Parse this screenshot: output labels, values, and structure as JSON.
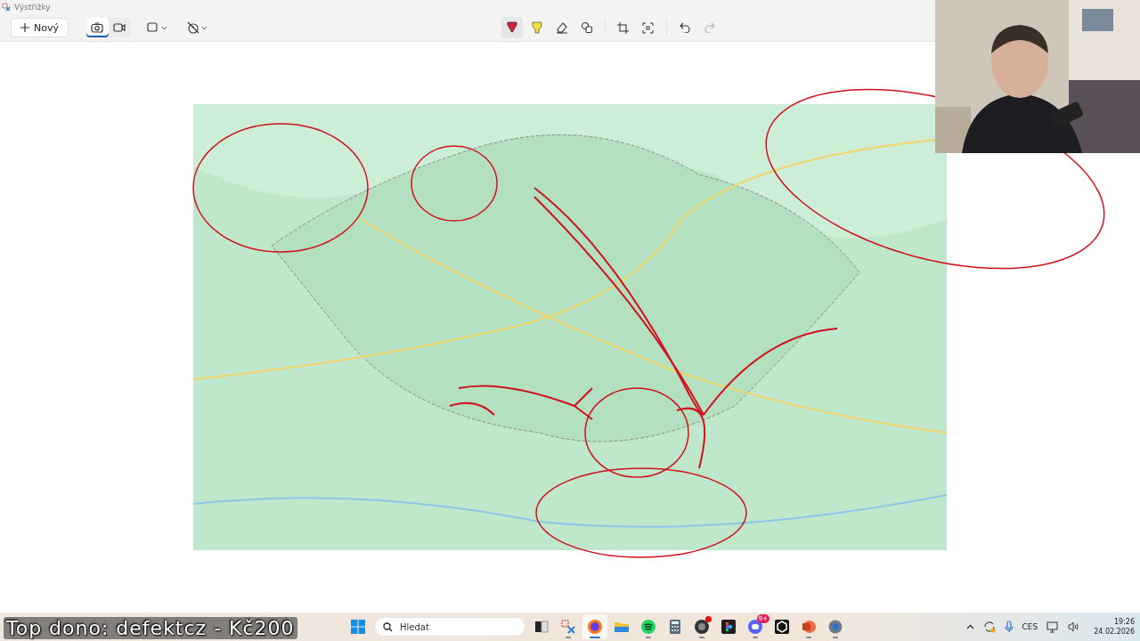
{
  "window": {
    "title": "Výstřižky"
  },
  "toolbar": {
    "new_button": {
      "label": "Nový"
    },
    "modes": [
      {
        "selected": true
      },
      {
        "selected": false
      }
    ],
    "tools": [
      {
        "selected": true
      },
      {
        "selected": false
      },
      {
        "selected": false
      },
      {
        "selected": false
      }
    ],
    "undo": {
      "disabled": false
    },
    "redo": {
      "disabled": true
    }
  },
  "overlay": {
    "text": "Top dono: defektcz - Kč200"
  },
  "taskbar": {
    "search": {
      "placeholder": "Hledat"
    },
    "apps": [
      {
        "running": false,
        "selected": false
      },
      {
        "running": true,
        "selected": false
      },
      {
        "running": true,
        "selected": true
      },
      {
        "running": false,
        "selected": false
      },
      {
        "running": true,
        "selected": false
      },
      {
        "running": false,
        "selected": false
      },
      {
        "running": true,
        "selected": false,
        "alert": true
      },
      {
        "running": false,
        "selected": false
      },
      {
        "running": true,
        "selected": false,
        "badge": "9+"
      },
      {
        "running": false,
        "selected": false
      },
      {
        "running": true,
        "selected": false
      },
      {
        "running": true,
        "selected": false
      }
    ],
    "language": "CES",
    "time": "19:26",
    "date": "24.02.2026"
  }
}
